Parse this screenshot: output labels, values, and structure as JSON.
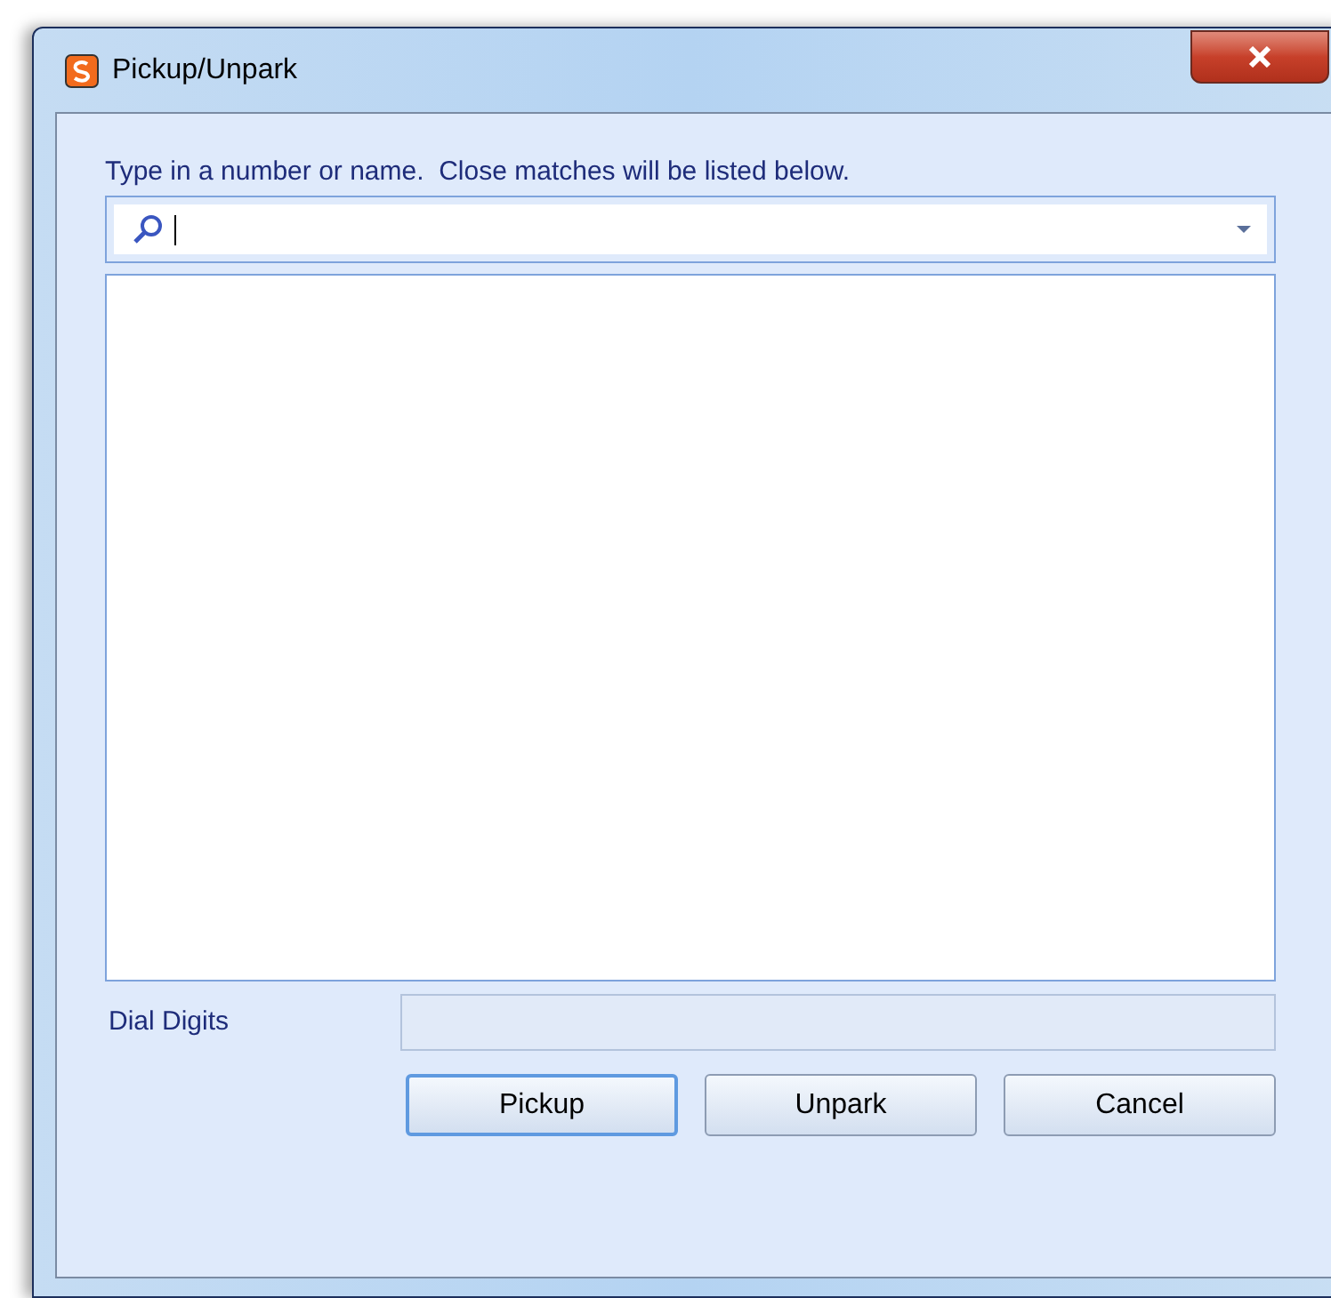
{
  "window": {
    "title": "Pickup/Unpark"
  },
  "prompt": "Type in a number or name.  Close matches will be listed below.",
  "dial_digits": {
    "label": "Dial Digits",
    "disabled": true
  },
  "buttons": [
    {
      "label": "Pickup",
      "default": true
    },
    {
      "label": "Unpark",
      "default": false
    },
    {
      "label": "Cancel",
      "default": false
    }
  ]
}
